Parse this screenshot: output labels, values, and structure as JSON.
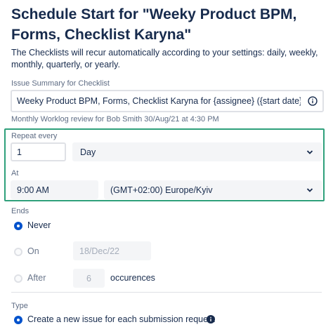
{
  "dialog": {
    "title": "Schedule Start for \"Weeky Product BPM, Forms, Checklist Karyna\"",
    "description": "The Checklists will recur automatically according to your settings: daily, weekly, monthly, quarterly, or yearly."
  },
  "summary": {
    "label": "Issue Summary for Checklist",
    "value": "Weeky Product BPM, Forms, Checklist Karyna for {assignee} ({start date} at {start time})",
    "info_icon": "info-icon",
    "preview": "Monthly Worklog review for Bob Smith 30/Aug/21 at 4:30 PM"
  },
  "repeat": {
    "label": "Repeat every",
    "interval_value": "1",
    "unit_selected": "Day",
    "at_label": "At",
    "time_value": "9:00 AM",
    "timezone_selected": "(GMT+02:00) Europe/Kyiv",
    "highlight_color": "#2fa07b"
  },
  "ends": {
    "label": "Ends",
    "never_label": "Never",
    "on_label": "On",
    "on_date": "18/Dec/22",
    "after_label": "After",
    "after_count": "6",
    "occurrences_label": "occurences",
    "selected": "Never"
  },
  "type": {
    "label": "Type",
    "option_label": "Create a new issue for each submission request",
    "info_icon": "info-icon"
  },
  "colors": {
    "text": "#172b4d",
    "muted": "#5e6c84",
    "accent": "#0052cc"
  }
}
